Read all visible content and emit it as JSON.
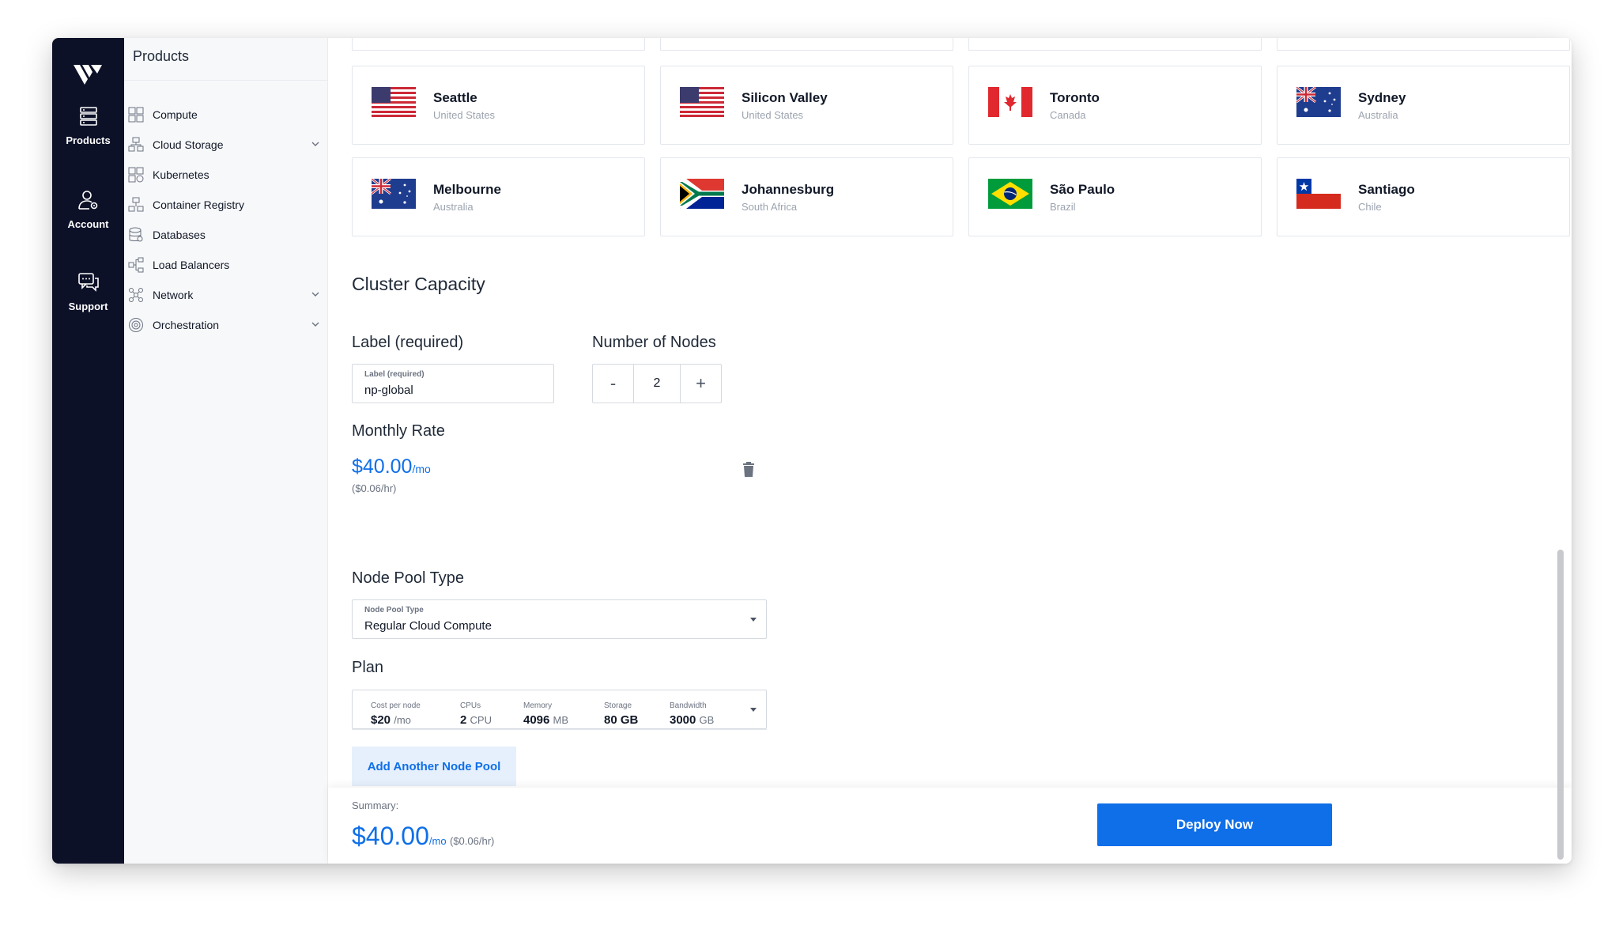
{
  "rail": {
    "items": [
      {
        "label": "Products",
        "icon": "server-stack-icon"
      },
      {
        "label": "Account",
        "icon": "user-settings-icon"
      },
      {
        "label": "Support",
        "icon": "chat-bubbles-icon"
      }
    ]
  },
  "sidebar": {
    "title": "Products",
    "items": [
      {
        "label": "Compute",
        "icon": "compute-icon"
      },
      {
        "label": "Cloud Storage",
        "icon": "cloud-storage-icon"
      },
      {
        "label": "Kubernetes",
        "icon": "kubernetes-icon"
      },
      {
        "label": "Container Registry",
        "icon": "container-registry-icon"
      },
      {
        "label": "Databases",
        "icon": "databases-icon"
      },
      {
        "label": "Load Balancers",
        "icon": "load-balancers-icon"
      },
      {
        "label": "Network",
        "icon": "network-icon"
      },
      {
        "label": "Orchestration",
        "icon": "orchestration-icon"
      }
    ]
  },
  "locations": [
    {
      "city": "Seattle",
      "country": "United States",
      "flag": "us"
    },
    {
      "city": "Silicon Valley",
      "country": "United States",
      "flag": "us"
    },
    {
      "city": "Toronto",
      "country": "Canada",
      "flag": "ca"
    },
    {
      "city": "Sydney",
      "country": "Australia",
      "flag": "au"
    },
    {
      "city": "Melbourne",
      "country": "Australia",
      "flag": "au"
    },
    {
      "city": "Johannesburg",
      "country": "South Africa",
      "flag": "za"
    },
    {
      "city": "São Paulo",
      "country": "Brazil",
      "flag": "br"
    },
    {
      "city": "Santiago",
      "country": "Chile",
      "flag": "cl"
    }
  ],
  "cluster": {
    "title": "Cluster Capacity",
    "label_title": "Label (required)",
    "label_field": {
      "mini": "Label (required)",
      "value": "np-global"
    },
    "nodes_title": "Number of Nodes",
    "nodes": {
      "minus": "-",
      "value": "2",
      "plus": "+"
    },
    "rate_title": "Monthly Rate",
    "rate": {
      "amount": "$40.00",
      "per": "/mo",
      "hourly": "($0.06/hr)"
    },
    "pool_type_title": "Node Pool Type",
    "pool_type": {
      "mini": "Node Pool Type",
      "value": "Regular Cloud Compute"
    },
    "plan_title": "Plan",
    "plan": [
      {
        "label": "Cost per node",
        "value": "$20",
        "unit": "/mo"
      },
      {
        "label": "CPUs",
        "value": "2",
        "unit": "CPU"
      },
      {
        "label": "Memory",
        "value": "4096",
        "unit": "MB"
      },
      {
        "label": "Storage",
        "value": "80 GB",
        "unit": ""
      },
      {
        "label": "Bandwidth",
        "value": "3000",
        "unit": "GB"
      }
    ],
    "add_pool": "Add Another Node Pool"
  },
  "footer": {
    "summary_label": "Summary:",
    "amount": "$40.00",
    "per": "/mo",
    "hourly": "($0.06/hr)",
    "deploy": "Deploy Now"
  },
  "colors": {
    "accent": "#0f6fe8",
    "rail": "#0d1128"
  }
}
